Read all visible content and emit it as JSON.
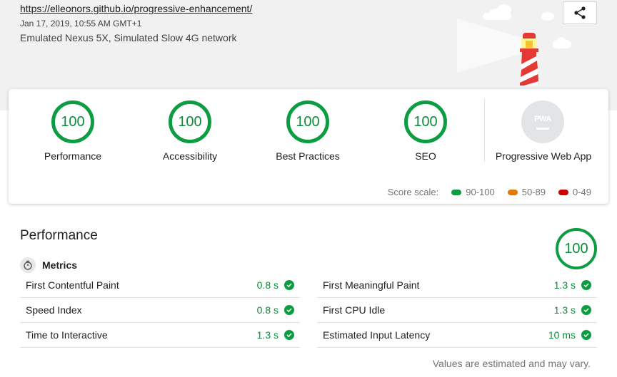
{
  "header": {
    "url": "https://elleonors.github.io/progressive-enhancement/",
    "date": "Jan 17, 2019, 10:55 AM GMT+1",
    "environment": "Emulated Nexus 5X, Simulated Slow 4G network",
    "share_icon": "share-icon"
  },
  "summary": {
    "categories": [
      {
        "score": "100",
        "label": "Performance"
      },
      {
        "score": "100",
        "label": "Accessibility"
      },
      {
        "score": "100",
        "label": "Best Practices"
      },
      {
        "score": "100",
        "label": "SEO"
      }
    ],
    "pwa": {
      "badge_text": "PWA",
      "label": "Progressive Web App"
    },
    "score_scale": {
      "label": "Score scale:",
      "ranges": [
        {
          "text": "90-100",
          "color": "#0c9d43"
        },
        {
          "text": "50-89",
          "color": "#e67700"
        },
        {
          "text": "0-49",
          "color": "#cc0000"
        }
      ]
    }
  },
  "performance": {
    "title": "Performance",
    "score": "100",
    "metrics_title": "Metrics",
    "metrics_icon": "timer-icon",
    "metrics": [
      {
        "name": "First Contentful Paint",
        "value": "0.8 s"
      },
      {
        "name": "First Meaningful Paint",
        "value": "1.3 s"
      },
      {
        "name": "Speed Index",
        "value": "0.8 s"
      },
      {
        "name": "First CPU Idle",
        "value": "1.3 s"
      },
      {
        "name": "Time to Interactive",
        "value": "1.3 s"
      },
      {
        "name": "Estimated Input Latency",
        "value": "10 ms"
      }
    ],
    "note": "Values are estimated and may vary."
  },
  "colors": {
    "pass": "#0c9d43",
    "average": "#e67700",
    "fail": "#cc0000"
  }
}
